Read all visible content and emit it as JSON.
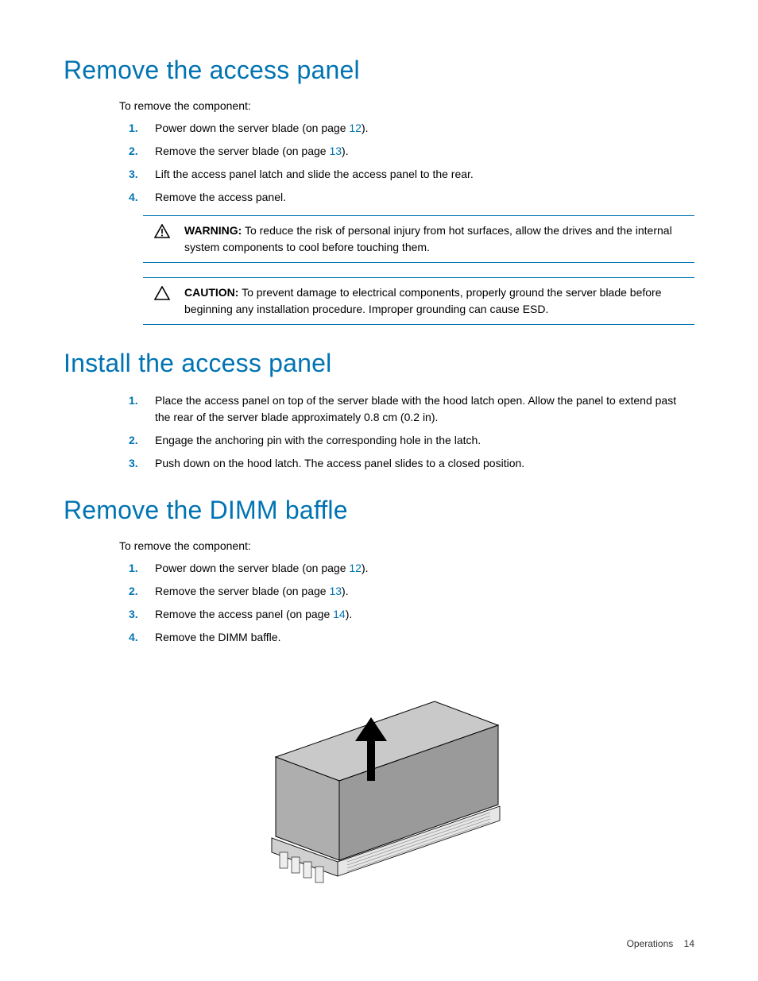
{
  "sections": {
    "remove_panel": {
      "heading": "Remove the access panel",
      "intro": "To remove the component:",
      "steps": [
        {
          "pre": "Power down the server blade (on page ",
          "link": "12",
          "post": ")."
        },
        {
          "pre": "Remove the server blade (on page ",
          "link": "13",
          "post": ")."
        },
        {
          "pre": "Lift the access panel latch and slide the access panel to the rear."
        },
        {
          "pre": "Remove the access panel."
        }
      ],
      "warning_label": "WARNING:",
      "warning_text": "To reduce the risk of personal injury from hot surfaces, allow the drives and the internal system components to cool before touching them.",
      "caution_label": "CAUTION:",
      "caution_text": "To prevent damage to electrical components, properly ground the server blade before beginning any installation procedure. Improper grounding can cause ESD."
    },
    "install_panel": {
      "heading": "Install the access panel",
      "steps": [
        {
          "pre": "Place the access panel on top of the server blade with the hood latch open. Allow the panel to extend past the rear of the server blade approximately 0.8 cm (0.2 in)."
        },
        {
          "pre": "Engage the anchoring pin with the corresponding hole in the latch."
        },
        {
          "pre": "Push down on the hood latch. The access panel slides to a closed position."
        }
      ]
    },
    "remove_dimm": {
      "heading": "Remove the DIMM baffle",
      "intro": "To remove the component:",
      "steps": [
        {
          "pre": "Power down the server blade (on page ",
          "link": "12",
          "post": ")."
        },
        {
          "pre": "Remove the server blade (on page ",
          "link": "13",
          "post": ")."
        },
        {
          "pre": "Remove the access panel (on page ",
          "link": "14",
          "post": ")."
        },
        {
          "pre": "Remove the DIMM baffle."
        }
      ]
    }
  },
  "footer": {
    "section": "Operations",
    "page": "14"
  }
}
